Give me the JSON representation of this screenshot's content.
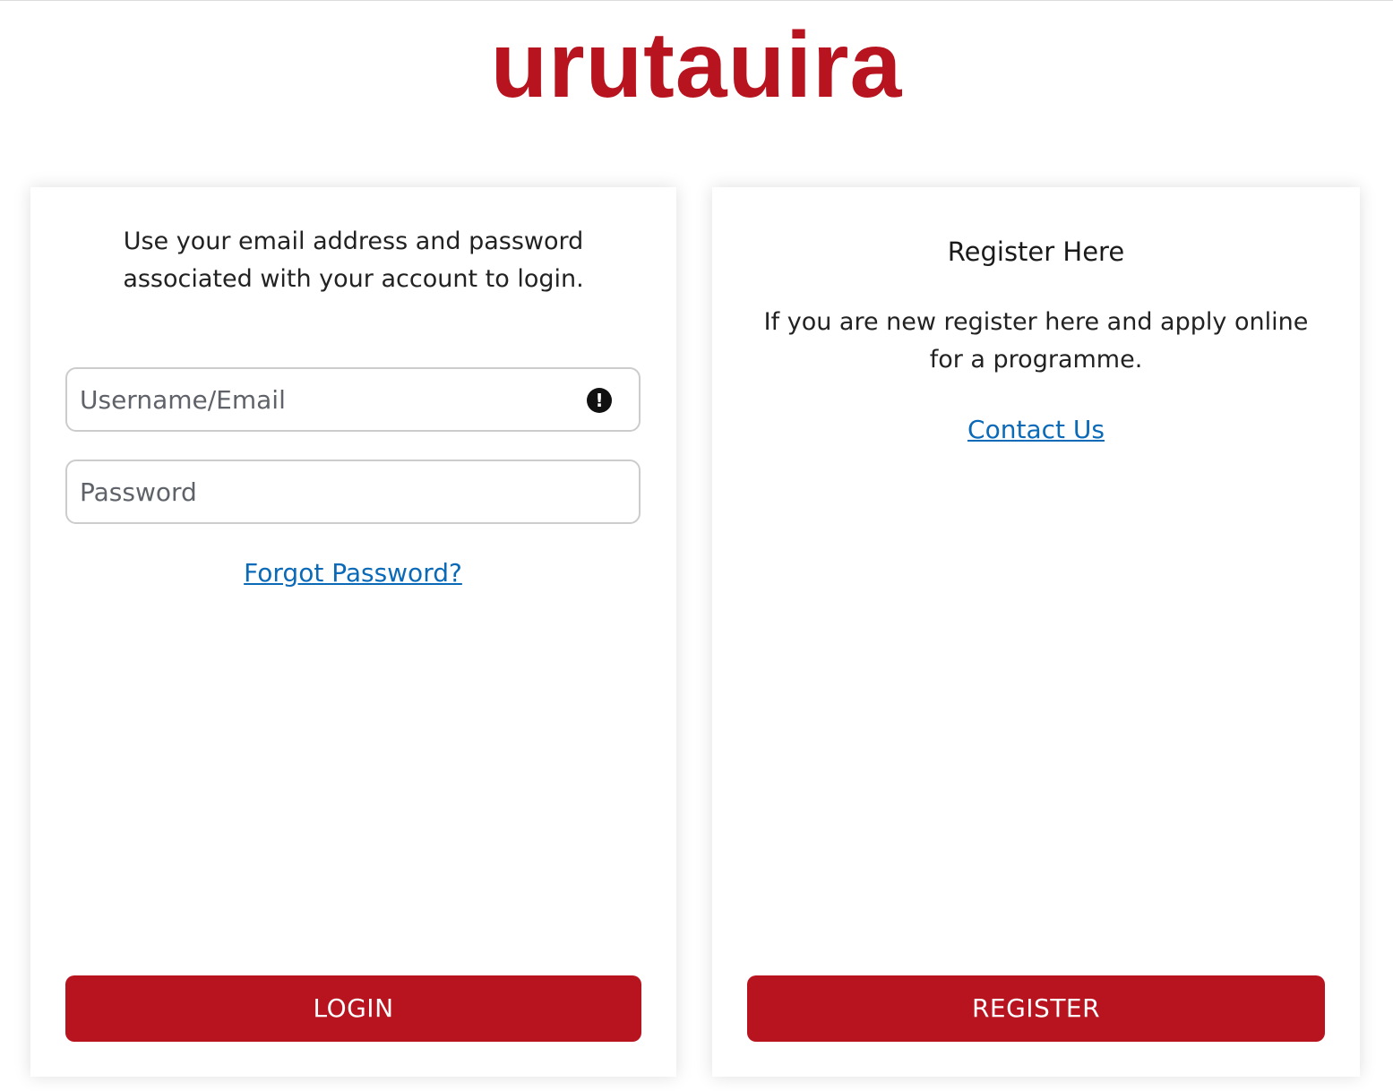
{
  "brand": {
    "logo_text": "urutauira",
    "accent_color": "#b8141f"
  },
  "login": {
    "intro": "Use your email address and password associated with your account to login.",
    "username_placeholder": "Username/Email",
    "username_value": "",
    "username_alert_icon": "exclamation-circle-icon",
    "password_placeholder": "Password",
    "password_value": "",
    "forgot_password": "Forgot Password?",
    "button": "LOGIN"
  },
  "register": {
    "title": "Register Here",
    "text": "If you are new register here and apply online for a programme.",
    "contact_link": "Contact Us",
    "button": "REGISTER"
  },
  "link_color": "#0a6ab8"
}
